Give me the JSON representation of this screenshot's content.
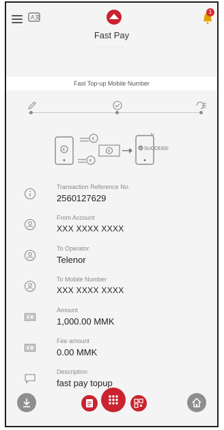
{
  "header": {
    "title": "Fast Pay",
    "subtitle_dots": "··········",
    "notification_count": "1"
  },
  "service": {
    "label": "Fast Top-up Mobile Number"
  },
  "illustration": {
    "success_text": "SUCCESS!"
  },
  "details": [
    {
      "label": "Transaction Reference No.",
      "value": "2560127629",
      "icon": "info-icon"
    },
    {
      "label": "From Account",
      "value": "XXX XXXX XXXX",
      "icon": "account-icon"
    },
    {
      "label": "To Operator",
      "value": "Telenor",
      "icon": "operator-icon"
    },
    {
      "label": "To Mobile Number",
      "value": "XXX XXXX XXXX",
      "icon": "mobile-icon"
    },
    {
      "label": "Amount",
      "value": "1,000.00 MMK",
      "icon": "money-icon"
    },
    {
      "label": "Fee amount",
      "value": "0.00 MMK",
      "icon": "fee-icon"
    },
    {
      "label": "Description",
      "value": "fast pay topup",
      "icon": "description-icon"
    }
  ],
  "colors": {
    "accent": "#c9232f",
    "muted": "#8e8e8e",
    "background": "#f4f4f4"
  }
}
